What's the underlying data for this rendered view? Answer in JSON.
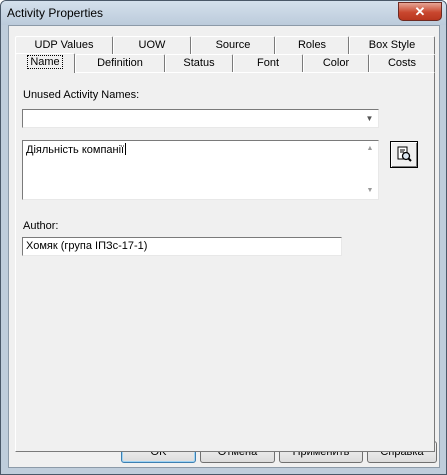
{
  "window": {
    "title": "Activity Properties",
    "close_glyph": "✕"
  },
  "tabs_back_row": [
    "UDP Values",
    "UOW",
    "Source",
    "Roles",
    "Box Style"
  ],
  "tabs_front_row": [
    "Name",
    "Definition",
    "Status",
    "Font",
    "Color",
    "Costs"
  ],
  "active_tab": "Name",
  "name_tab": {
    "unused_label": "Unused Activity Names:",
    "unused_value": "",
    "name_value": "Діяльність компанії",
    "author_label": "Author:",
    "author_value": "Хомяк (група ІПЗс-17-1)"
  },
  "icons": {
    "combo_arrow": "▼",
    "scroll_up": "▲",
    "scroll_down": "▼",
    "find": "magnifier-document-icon"
  },
  "buttons": {
    "ok": "OK",
    "cancel": "Отмена",
    "apply": "Применить",
    "help": "Справка"
  },
  "colors": {
    "title_bar": "#bccbdb",
    "close_button": "#c9472f",
    "dialog_bg": "#f0f0f0",
    "default_button_border": "#3c7fb1"
  }
}
